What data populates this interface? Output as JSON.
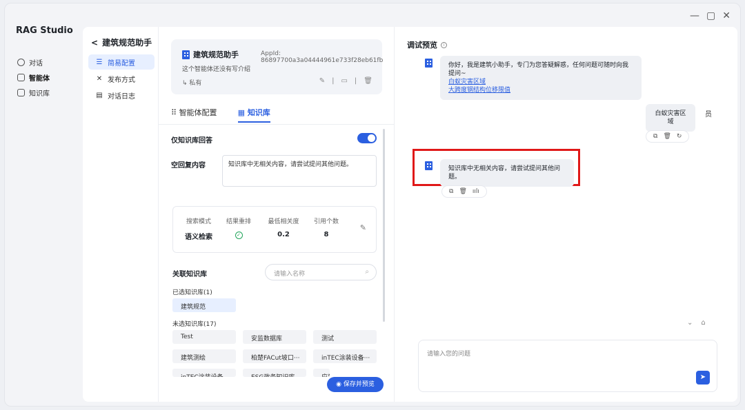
{
  "window": {
    "minimize": "—",
    "maximize": "▢",
    "close": "✕"
  },
  "app": {
    "name": "RAG Studio"
  },
  "appnav": [
    {
      "label": "对话",
      "icon": "chat-icon"
    },
    {
      "label": "智能体",
      "icon": "cube-icon"
    },
    {
      "label": "知识库",
      "icon": "book-icon"
    }
  ],
  "subnav": {
    "back": "<",
    "title": "建筑规范助手",
    "items": [
      {
        "label": "简易配置",
        "glyph": "☰"
      },
      {
        "label": "发布方式",
        "glyph": "✕"
      },
      {
        "label": "对话日志",
        "glyph": "▤"
      }
    ]
  },
  "agent": {
    "name": "建筑规范助手",
    "appid": "AppId: 86897700a3a04444961e733f28eb61fb",
    "desc": "这个智能体还没有写介绍",
    "visibility": "私有",
    "visibility_glyph": "↳"
  },
  "tabs": [
    {
      "label": "智能体配置",
      "glyph": "⠿"
    },
    {
      "label": "知识库",
      "glyph": "▦"
    }
  ],
  "config": {
    "kb_only_label": "仅知识库回答",
    "kb_only_on": true,
    "empty_reply_label": "空回复内容",
    "empty_reply_value": "知识库中无相关内容，请尝试提问其他问题。",
    "search": {
      "mode_key": "搜索模式",
      "mode_val": "语义检索",
      "rerank_key": "结果重排",
      "rerank_val": "✓",
      "min_rel_key": "最低相关度",
      "min_rel_val": "0.2",
      "cite_key": "引用个数",
      "cite_val": "8",
      "edit": "✎"
    },
    "linked_kb_label": "关联知识库",
    "kb_search_placeholder": "请输入名称",
    "selected_label": "已选知识库(1)",
    "selected": [
      "建筑规范"
    ],
    "unselected_label": "未选知识库(17)",
    "unselected": [
      "Test",
      "安监数据库",
      "测试",
      "建筑测绘",
      "柏楚FACut坡口···",
      "inTEC涂装设备···",
      "inTEC涂装设备",
      "ESG政务知识库",
      "应到数据库"
    ],
    "save_button": "◉ 保存并预览"
  },
  "preview": {
    "title": "调试预览",
    "info": "i",
    "greeting": "你好，我是建筑小助手，专门为您答疑解惑，任何问题可随时向我提问~",
    "suggestions": [
      "白蚁灾害区域",
      "大跨度钢结构位移限值"
    ],
    "user_msg": "白蚁灾害区域",
    "user_avatar": "员",
    "bot_reply": "知识库中无相关内容，请尝试提问其他问题。",
    "acts_user": [
      "⧉",
      "🗑",
      "↻"
    ],
    "acts_bot": [
      "⧉",
      "🗑",
      "ıılı"
    ],
    "input_placeholder": "请输入您的问题",
    "send": "➤",
    "scroll_down": "⌄",
    "clear": "⌂"
  }
}
